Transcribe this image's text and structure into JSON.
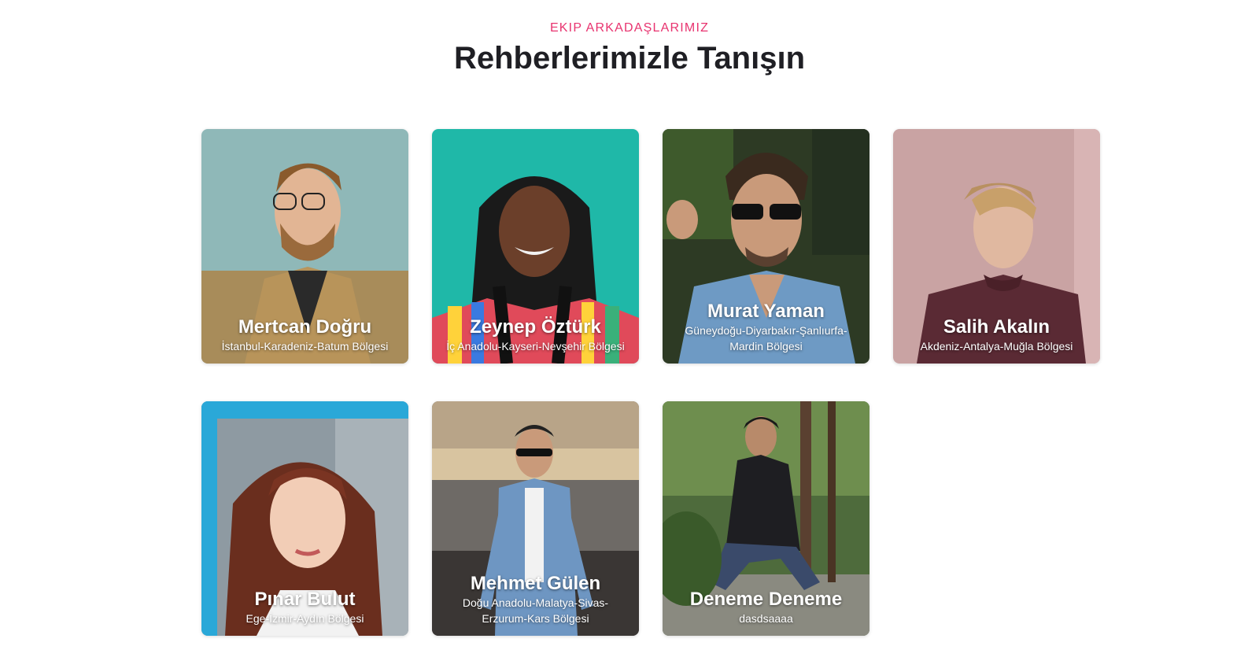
{
  "section": {
    "eyebrow": "EKIP ARKADAŞLARIMIZ",
    "title": "Rehberlerimizle Tanışın"
  },
  "guides": [
    {
      "name": "Mertcan Doğru",
      "region": "İstanbul-Karadeniz-Batum Bölgesi",
      "bg": "#8fb8b8"
    },
    {
      "name": "Zeynep Öztürk",
      "region": "İç Anadolu-Kayseri-Nevşehir Bölgesi",
      "bg": "#1fb8a8"
    },
    {
      "name": "Murat Yaman",
      "region": "Güneydoğu-Diyarbakır-Şanlıurfa-Mardin Bölgesi",
      "bg": "#2d3a24"
    },
    {
      "name": "Salih Akalın",
      "region": "Akdeniz-Antalya-Muğla Bölgesi",
      "bg": "#c9a3a3"
    },
    {
      "name": "Pınar Bulut",
      "region": "Ege-İzmir-Aydın Bölgesi",
      "bg": "#8e9aa2"
    },
    {
      "name": "Mehmet Gülen",
      "region": "Doğu Anadolu-Malatya-Sivas-Erzurum-Kars Bölgesi",
      "bg": "#6e6a66"
    },
    {
      "name": "Deneme Deneme",
      "region": "dasdsaaaa",
      "bg": "#4e6b3c"
    }
  ]
}
